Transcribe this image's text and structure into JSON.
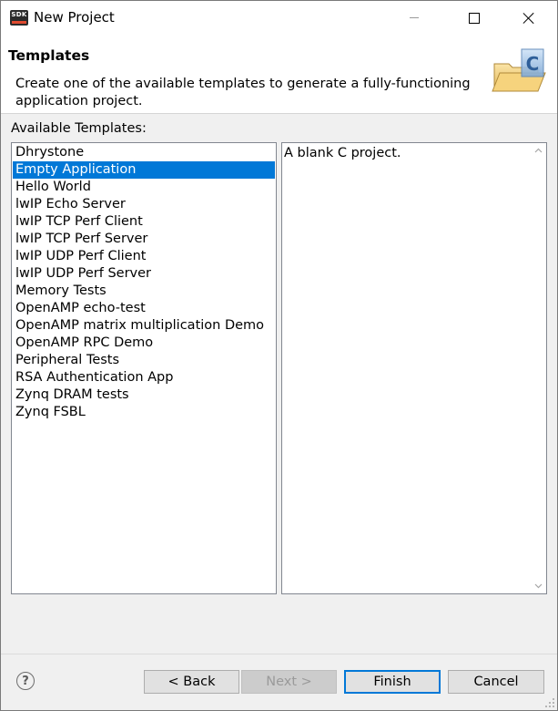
{
  "window": {
    "title": "New Project",
    "app_icon_text": "SDK"
  },
  "banner": {
    "title": "Templates",
    "description": "Create one of the available templates to generate a fully-functioning application project."
  },
  "templates": {
    "label": "Available Templates:",
    "items": [
      "Dhrystone",
      "Empty Application",
      "Hello World",
      "lwIP Echo Server",
      "lwIP TCP Perf Client",
      "lwIP TCP Perf Server",
      "lwIP UDP Perf Client",
      "lwIP UDP Perf Server",
      "Memory Tests",
      "OpenAMP echo-test",
      "OpenAMP matrix multiplication Demo",
      "OpenAMP RPC Demo",
      "Peripheral Tests",
      "RSA Authentication App",
      "Zynq DRAM tests",
      "Zynq FSBL"
    ],
    "selected": "Empty Application"
  },
  "description_panel": {
    "text": "A blank C project."
  },
  "footer": {
    "help_glyph": "?",
    "back_label": "< Back",
    "next_label": "Next >",
    "finish_label": "Finish",
    "cancel_label": "Cancel"
  },
  "colors": {
    "selection": "#0078d7",
    "finish_border": "#0078d7"
  }
}
